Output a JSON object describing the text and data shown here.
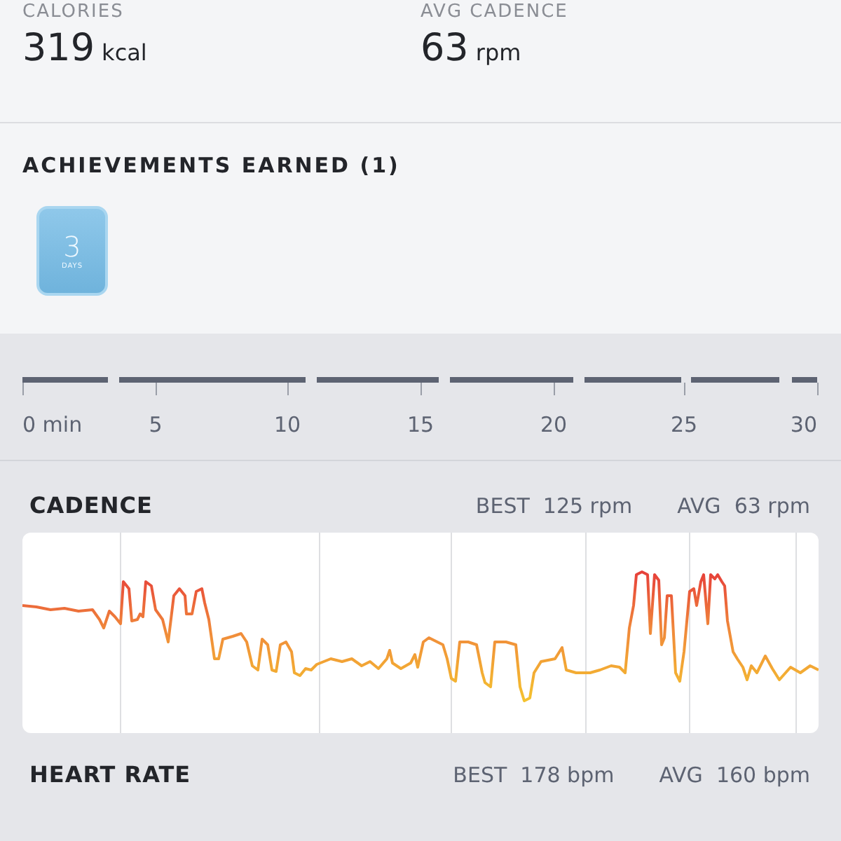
{
  "stats": [
    {
      "label": "CALORIES",
      "value": "319",
      "unit": "kcal"
    },
    {
      "label": "AVG CADENCE",
      "value": "63",
      "unit": "rpm"
    }
  ],
  "achievements": {
    "title": "ACHIEVEMENTS EARNED (1)",
    "badges": [
      {
        "number": "3",
        "caption": "DAYS"
      }
    ]
  },
  "timeline": {
    "labels": [
      "0 min",
      "5",
      "10",
      "15",
      "20",
      "25",
      "30"
    ]
  },
  "sections": [
    {
      "title": "CADENCE",
      "best_label": "BEST",
      "best": "125 rpm",
      "avg_label": "AVG",
      "avg": "63 rpm"
    },
    {
      "title": "HEART RATE",
      "best_label": "BEST",
      "best": "178 bpm",
      "avg_label": "AVG",
      "avg": "160 bpm"
    }
  ]
}
